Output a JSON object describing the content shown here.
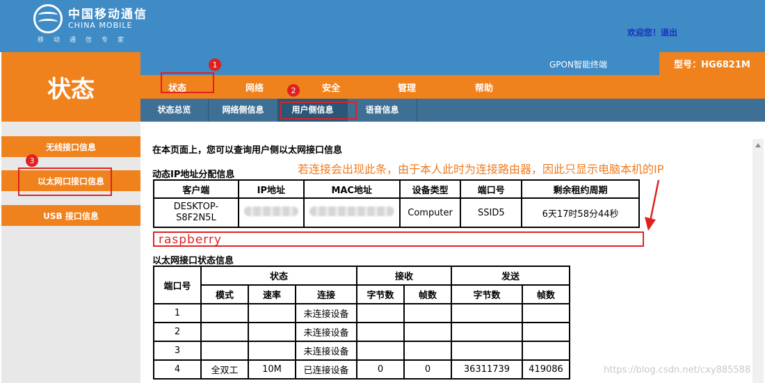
{
  "header": {
    "logo_cn": "中国移动通信",
    "logo_en": "CHINA MOBILE",
    "logo_sub": "移动通信专家",
    "welcome": "欢迎您！",
    "logout": "退出"
  },
  "page_title": "状态",
  "info": {
    "gpon": "GPON智能终端",
    "model": "型号：HG6821M"
  },
  "main_nav": [
    "状态",
    "网络",
    "安全",
    "管理",
    "帮助"
  ],
  "sub_nav": [
    "状态总览",
    "网络侧信息",
    "用户侧信息",
    "语音信息"
  ],
  "side_menu": [
    "无线接口信息",
    "以太网口接口信息",
    "USB 接口信息"
  ],
  "content": {
    "intro": "在本页面上，您可以查询用户侧以太网接口信息",
    "dhcp_title": "动态IP地址分配信息",
    "dhcp_headers": [
      "客户端",
      "IP地址",
      "MAC地址",
      "设备类型",
      "端口号",
      "剩余租约周期"
    ],
    "dhcp_row": {
      "client": "DESKTOP-S8F2N5L",
      "device_type": "Computer",
      "port": "SSID5",
      "lease": "6天17时58分44秒"
    },
    "eth_title": "以太网接口状态信息",
    "eth_headers": {
      "port": "端口号",
      "status": "状态",
      "receive": "接收",
      "send": "发送"
    },
    "eth_subheaders": [
      "模式",
      "速率",
      "连接",
      "字节数",
      "帧数",
      "字节数",
      "帧数"
    ],
    "eth_rows": [
      {
        "port": "1",
        "mode": "",
        "rate": "",
        "link": "未连接设备",
        "rx_bytes": "",
        "rx_frames": "",
        "tx_bytes": "",
        "tx_frames": ""
      },
      {
        "port": "2",
        "mode": "",
        "rate": "",
        "link": "未连接设备",
        "rx_bytes": "",
        "rx_frames": "",
        "tx_bytes": "",
        "tx_frames": ""
      },
      {
        "port": "3",
        "mode": "",
        "rate": "",
        "link": "未连接设备",
        "rx_bytes": "",
        "rx_frames": "",
        "tx_bytes": "",
        "tx_frames": ""
      },
      {
        "port": "4",
        "mode": "全双工",
        "rate": "10M",
        "link": "已连接设备",
        "rx_bytes": "0",
        "rx_frames": "0",
        "tx_bytes": "36311739",
        "tx_frames": "419086"
      }
    ]
  },
  "annotations": {
    "n1": "1",
    "n2": "2",
    "n3": "3",
    "note": "若连接会出现此条，由于本人此时为连接路由器，因此只显示电脑本机的IP",
    "raspberry": "raspberry"
  },
  "watermark": "https://blog.csdn.net/cxy885588",
  "colors": {
    "header_blue": "#3e8bc5",
    "orange": "#f0821e",
    "subnav_blue": "#3e6f95",
    "annotation_red": "#e02020"
  }
}
